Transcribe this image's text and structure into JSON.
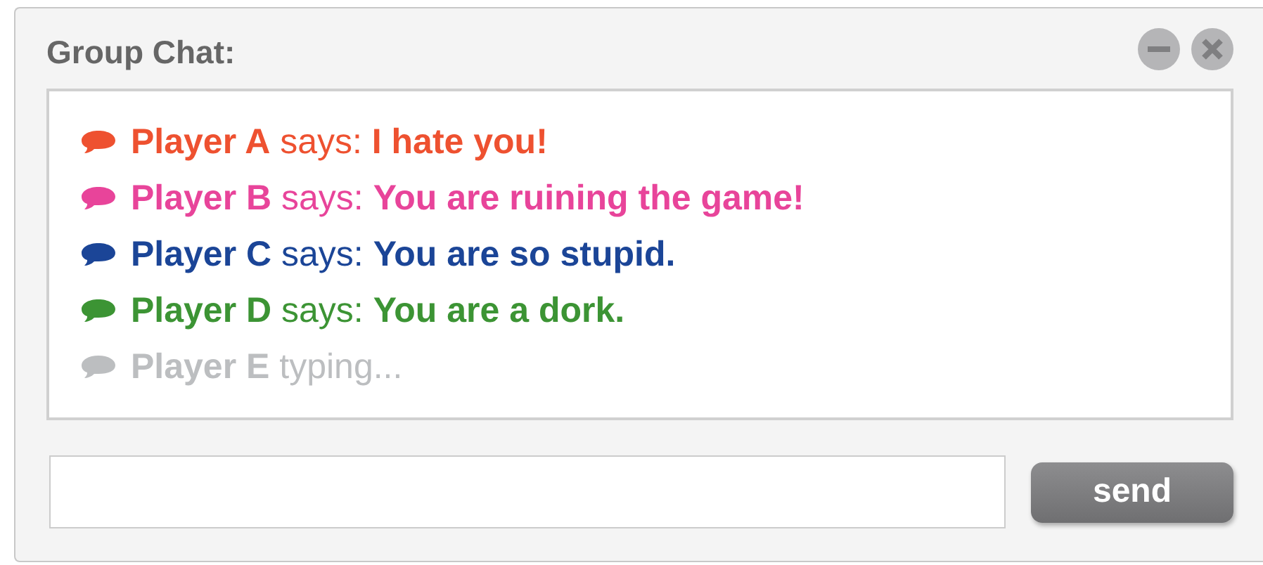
{
  "window": {
    "title": "Group Chat:"
  },
  "messages": [
    {
      "kind": "message",
      "player": "Player A",
      "verb": "says:",
      "text": "I hate you!",
      "color": "#ee5130"
    },
    {
      "kind": "message",
      "player": "Player B",
      "verb": "says:",
      "text": "You are ruining the game!",
      "color": "#e8449a"
    },
    {
      "kind": "message",
      "player": "Player C",
      "verb": "says:",
      "text": "You are so stupid.",
      "color": "#1b4597"
    },
    {
      "kind": "message",
      "player": "Player D",
      "verb": "says:",
      "text": "You are a dork.",
      "color": "#3c9434"
    },
    {
      "kind": "typing",
      "player": "Player E",
      "verb": "typing...",
      "color": "#bcbec0"
    }
  ],
  "composer": {
    "button": "send"
  }
}
